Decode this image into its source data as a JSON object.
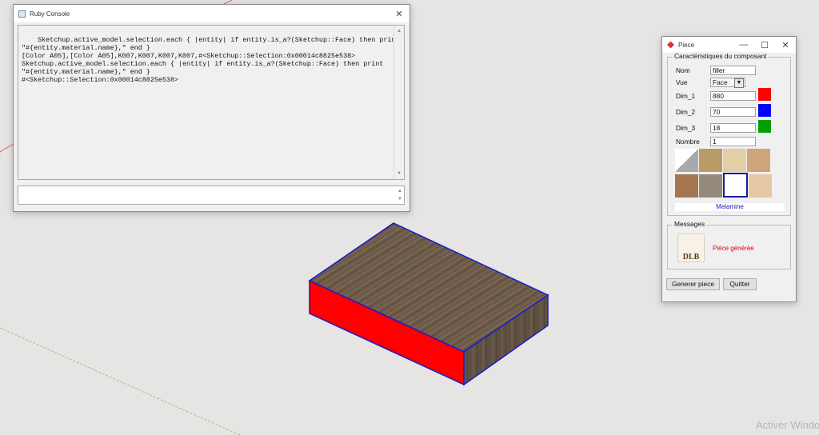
{
  "ruby_console": {
    "title": "Ruby Console",
    "output": "Sketchup.active_model.selection.each { |entity| if entity.is_a?(Sketchup::Face) then print\n\"#{entity.material.name},\" end }\n[Color A05],[Color A05],K007,K007,K007,K007,#<Sketchup::Selection:0x00014c8825e538>\nSketchup.active_model.selection.each { |entity| if entity.is_a?(Sketchup::Face) then print\n\"#{entity.material.name},\" end }\n#<Sketchup::Selection:0x00014c8825e538>",
    "input": ""
  },
  "piece_dialog": {
    "title": "Piece",
    "group_title": "Caractéristiques du composant",
    "nom_label": "Nom",
    "nom_value": "filler",
    "vue_label": "Vue",
    "vue_value": "Face",
    "dim1_label": "Dim_1",
    "dim1_value": "880",
    "dim1_color": "#ff0000",
    "dim2_label": "Dim_2",
    "dim2_value": "70",
    "dim2_color": "#0000ff",
    "dim3_label": "Dim_3",
    "dim3_value": "18",
    "dim3_color": "#00a000",
    "nombre_label": "Nombre",
    "nombre_value": "1",
    "material_name": "Melamine",
    "messages_title": "Messages",
    "logo_text": "DLB",
    "message_text": "Pièce générée",
    "generate_button": "Generer piece",
    "quit_button": "Quitter"
  },
  "watermark": "Activer Windo"
}
